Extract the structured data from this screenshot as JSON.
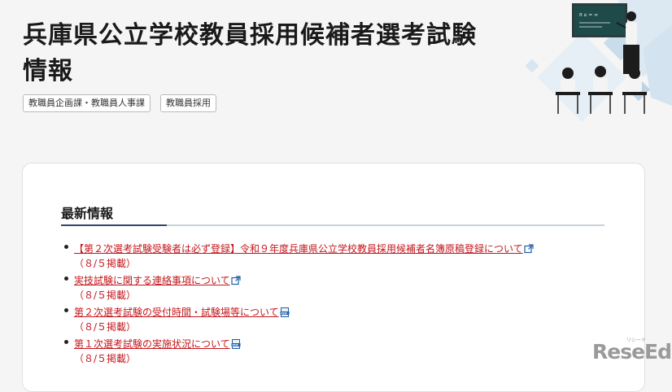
{
  "page": {
    "title": "兵庫県公立学校教員採用候補者選考試験情報"
  },
  "tags": [
    "教職員企画課・教職員人事課",
    "教職員採用"
  ],
  "section": {
    "title": "最新情報"
  },
  "news": [
    {
      "title": "【第２次選考試験受験者は必ず登録】令和９年度兵庫県公立学校教員採用候補者名簿原稿登録について",
      "date": "（８/５掲載）",
      "icon": "external-link-icon"
    },
    {
      "title": "実技試験に関する連絡事項について",
      "date": "（８/５掲載）",
      "icon": "external-link-icon"
    },
    {
      "title": "第２次選考試験の受付時間・試験場等について",
      "date": "（８/５掲載）",
      "icon": "pdf-icon"
    },
    {
      "title": "第１次選考試験の実施状況について",
      "date": "（８/５掲載）",
      "icon": "pdf-icon"
    }
  ],
  "colors": {
    "link": "#c4161c",
    "accent": "#2f4a6a",
    "background": "#f5f5f5"
  },
  "watermark": {
    "text": "ReseEd",
    "kana": "リシード"
  }
}
